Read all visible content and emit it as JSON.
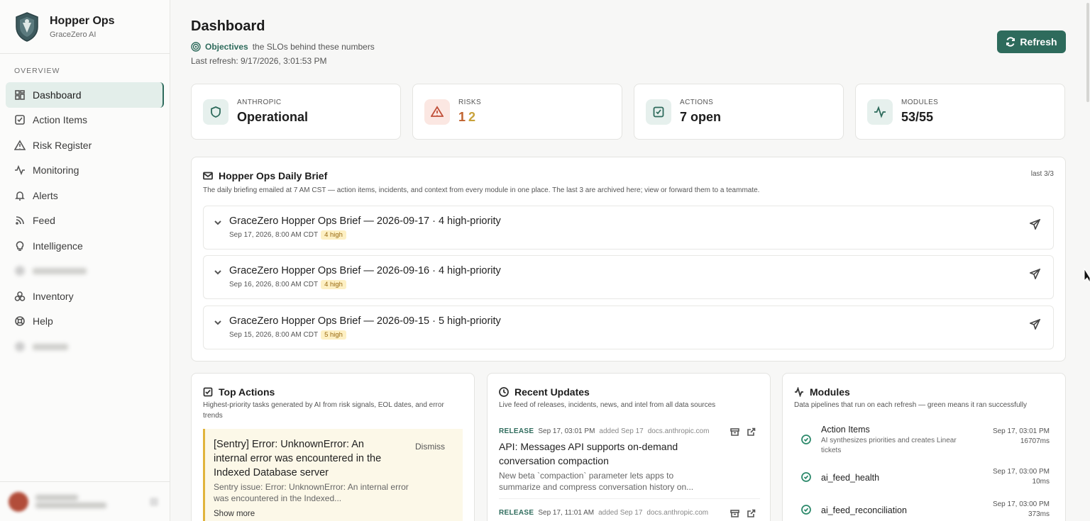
{
  "brand": {
    "title": "Hopper Ops",
    "subtitle": "GraceZero AI"
  },
  "sidebar": {
    "section_label": "OVERVIEW",
    "items": [
      {
        "label": "Dashboard",
        "icon": "grid-icon",
        "active": true
      },
      {
        "label": "Action Items",
        "icon": "checkbox-icon"
      },
      {
        "label": "Risk Register",
        "icon": "warning-icon"
      },
      {
        "label": "Monitoring",
        "icon": "activity-icon"
      },
      {
        "label": "Alerts",
        "icon": "bell-icon"
      },
      {
        "label": "Feed",
        "icon": "rss-icon"
      },
      {
        "label": "Intelligence",
        "icon": "lightbulb-icon"
      },
      {
        "label": "",
        "icon": "blurred-icon",
        "blurred": true
      },
      {
        "label": "Inventory",
        "icon": "boxes-icon"
      },
      {
        "label": "Help",
        "icon": "lifebuoy-icon"
      },
      {
        "label": "",
        "icon": "blurred-icon",
        "blurred": true
      }
    ]
  },
  "header": {
    "title": "Dashboard",
    "objectives_link": "Objectives",
    "objectives_text": "the SLOs behind these numbers",
    "last_refresh": "Last refresh: 9/17/2026, 3:01:53 PM",
    "refresh_label": "Refresh"
  },
  "stats": [
    {
      "label": "ANTHROPIC",
      "value": "Operational",
      "icon": "shield-icon"
    },
    {
      "label": "RISKS",
      "value_a": "1",
      "value_b": "2",
      "icon": "warning-icon"
    },
    {
      "label": "ACTIONS",
      "value": "7 open",
      "icon": "checkbox-icon"
    },
    {
      "label": "MODULES",
      "value": "53/55",
      "icon": "activity-icon"
    }
  ],
  "brief": {
    "title": "Hopper Ops Daily Brief",
    "description": "The daily briefing emailed at 7 AM CST — action items, incidents, and context from every module in one place. The last 3 are archived here; view or forward them to a teammate.",
    "count": "last 3/3",
    "items": [
      {
        "title": "GraceZero Hopper Ops Brief — 2026-09-17 · 4 high-priority",
        "date": "Sep 17, 2026, 8:00 AM CDT",
        "badge": "4 high"
      },
      {
        "title": "GraceZero Hopper Ops Brief — 2026-09-16 · 4 high-priority",
        "date": "Sep 16, 2026, 8:00 AM CDT",
        "badge": "4 high"
      },
      {
        "title": "GraceZero Hopper Ops Brief — 2026-09-15 · 5 high-priority",
        "date": "Sep 15, 2026, 8:00 AM CDT",
        "badge": "5 high"
      }
    ]
  },
  "top_actions": {
    "title": "Top Actions",
    "description": "Highest-priority tasks generated by AI from risk signals, EOL dates, and error trends",
    "card": {
      "title": "[Sentry] Error: UnknownError: An internal error was encountered in the Indexed Database server",
      "dismiss": "Dismiss",
      "description": "Sentry issue: Error: UnknownError: An internal error was encountered in the Indexed...",
      "show_more": "Show more"
    }
  },
  "recent_updates": {
    "title": "Recent Updates",
    "description": "Live feed of releases, incidents, news, and intel from all data sources",
    "items": [
      {
        "tag": "RELEASE",
        "date": "Sep 17, 03:01 PM",
        "added": "added Sep 17",
        "source": "docs.anthropic.com",
        "title": "API: Messages API supports on-demand conversation compaction",
        "description": "New beta `compaction` parameter lets apps to summarize and compress conversation history on..."
      },
      {
        "tag": "RELEASE",
        "date": "Sep 17, 11:01 AM",
        "added": "added Sep 17",
        "source": "docs.anthropic.com",
        "title": "",
        "description": ""
      }
    ]
  },
  "modules": {
    "title": "Modules",
    "description": "Data pipelines that run on each refresh — green means it ran successfully",
    "items": [
      {
        "name": "Action Items",
        "description": "AI synthesizes priorities and creates Linear tickets",
        "time": "Sep 17, 03:01 PM",
        "duration": "16707ms"
      },
      {
        "name": "ai_feed_health",
        "description": "",
        "time": "Sep 17, 03:00 PM",
        "duration": "10ms"
      },
      {
        "name": "ai_feed_reconciliation",
        "description": "",
        "time": "Sep 17, 03:00 PM",
        "duration": "373ms"
      }
    ]
  },
  "colors": {
    "accent": "#2e6b5c",
    "warning": "#c0622e",
    "badge_bg": "#fdf0c4"
  }
}
